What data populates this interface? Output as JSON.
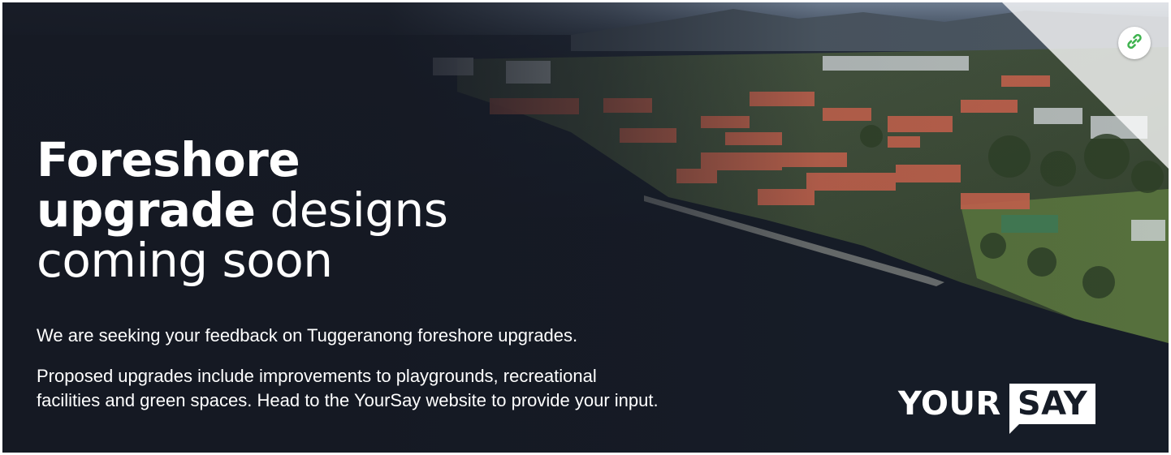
{
  "headline": {
    "line1_bold": "Foreshore",
    "line2_bold": "upgrade",
    "line2_regular": "designs",
    "line3_regular": "coming soon"
  },
  "paragraph1": "We are seeking your feedback on Tuggeranong foreshore upgrades.",
  "paragraph2_line1": "Proposed upgrades include improvements to playgrounds, recreational",
  "paragraph2_line2": "facilities and green spaces. Head to the YourSay website to provide your input.",
  "logo": {
    "part1": "YOUR",
    "part2": "SAY"
  },
  "icons": {
    "link": "link-icon"
  },
  "colors": {
    "background": "#161c27",
    "text": "#ffffff",
    "link_icon": "#3fb34f"
  }
}
